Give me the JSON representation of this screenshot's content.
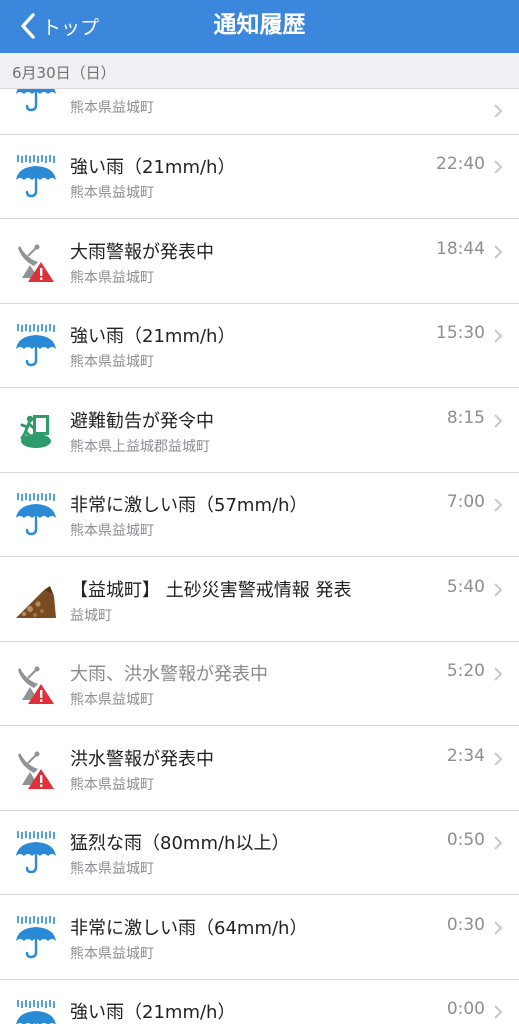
{
  "nav": {
    "back_label": "トップ",
    "title": "通知履歴"
  },
  "section": {
    "date": "6月30日（日）"
  },
  "partial_row": {
    "icon": "rain-icon",
    "subtitle": "熊本県益城町"
  },
  "items": [
    {
      "icon": "rain-icon",
      "title": "強い雨（21mm/h）",
      "subtitle": "熊本県益城町",
      "time": "22:40"
    },
    {
      "icon": "warning-icon",
      "title": "大雨警報が発表中",
      "subtitle": "熊本県益城町",
      "time": "18:44"
    },
    {
      "icon": "rain-icon",
      "title": "強い雨（21mm/h）",
      "subtitle": "熊本県益城町",
      "time": "15:30"
    },
    {
      "icon": "evacuation-icon",
      "title": "避難勧告が発令中",
      "subtitle": "熊本県上益城郡益城町",
      "time": "8:15"
    },
    {
      "icon": "rain-icon",
      "title": "非常に激しい雨（57mm/h）",
      "subtitle": "熊本県益城町",
      "time": "7:00"
    },
    {
      "icon": "landslide-icon",
      "title": "【益城町】 土砂災害警戒情報 発表",
      "subtitle": "益城町",
      "time": "5:40"
    },
    {
      "icon": "warning-icon",
      "title": "大雨、洪水警報が発表中",
      "subtitle": "熊本県益城町",
      "time": "5:20"
    },
    {
      "icon": "warning-icon",
      "title": "洪水警報が発表中",
      "subtitle": "熊本県益城町",
      "time": "2:34"
    },
    {
      "icon": "rain-icon",
      "title": "猛烈な雨（80mm/h以上）",
      "subtitle": "熊本県益城町",
      "time": "0:50"
    },
    {
      "icon": "rain-icon",
      "title": "非常に激しい雨（64mm/h）",
      "subtitle": "熊本県益城町",
      "time": "0:30"
    },
    {
      "icon": "rain-icon",
      "title": "強い雨（21mm/h）",
      "subtitle": "",
      "time": "0:00"
    }
  ],
  "colors": {
    "navbar": "#3a87db",
    "umbrella": "#2a8ad6",
    "warning": "#e0303a",
    "evacuation": "#2f9a6a"
  }
}
